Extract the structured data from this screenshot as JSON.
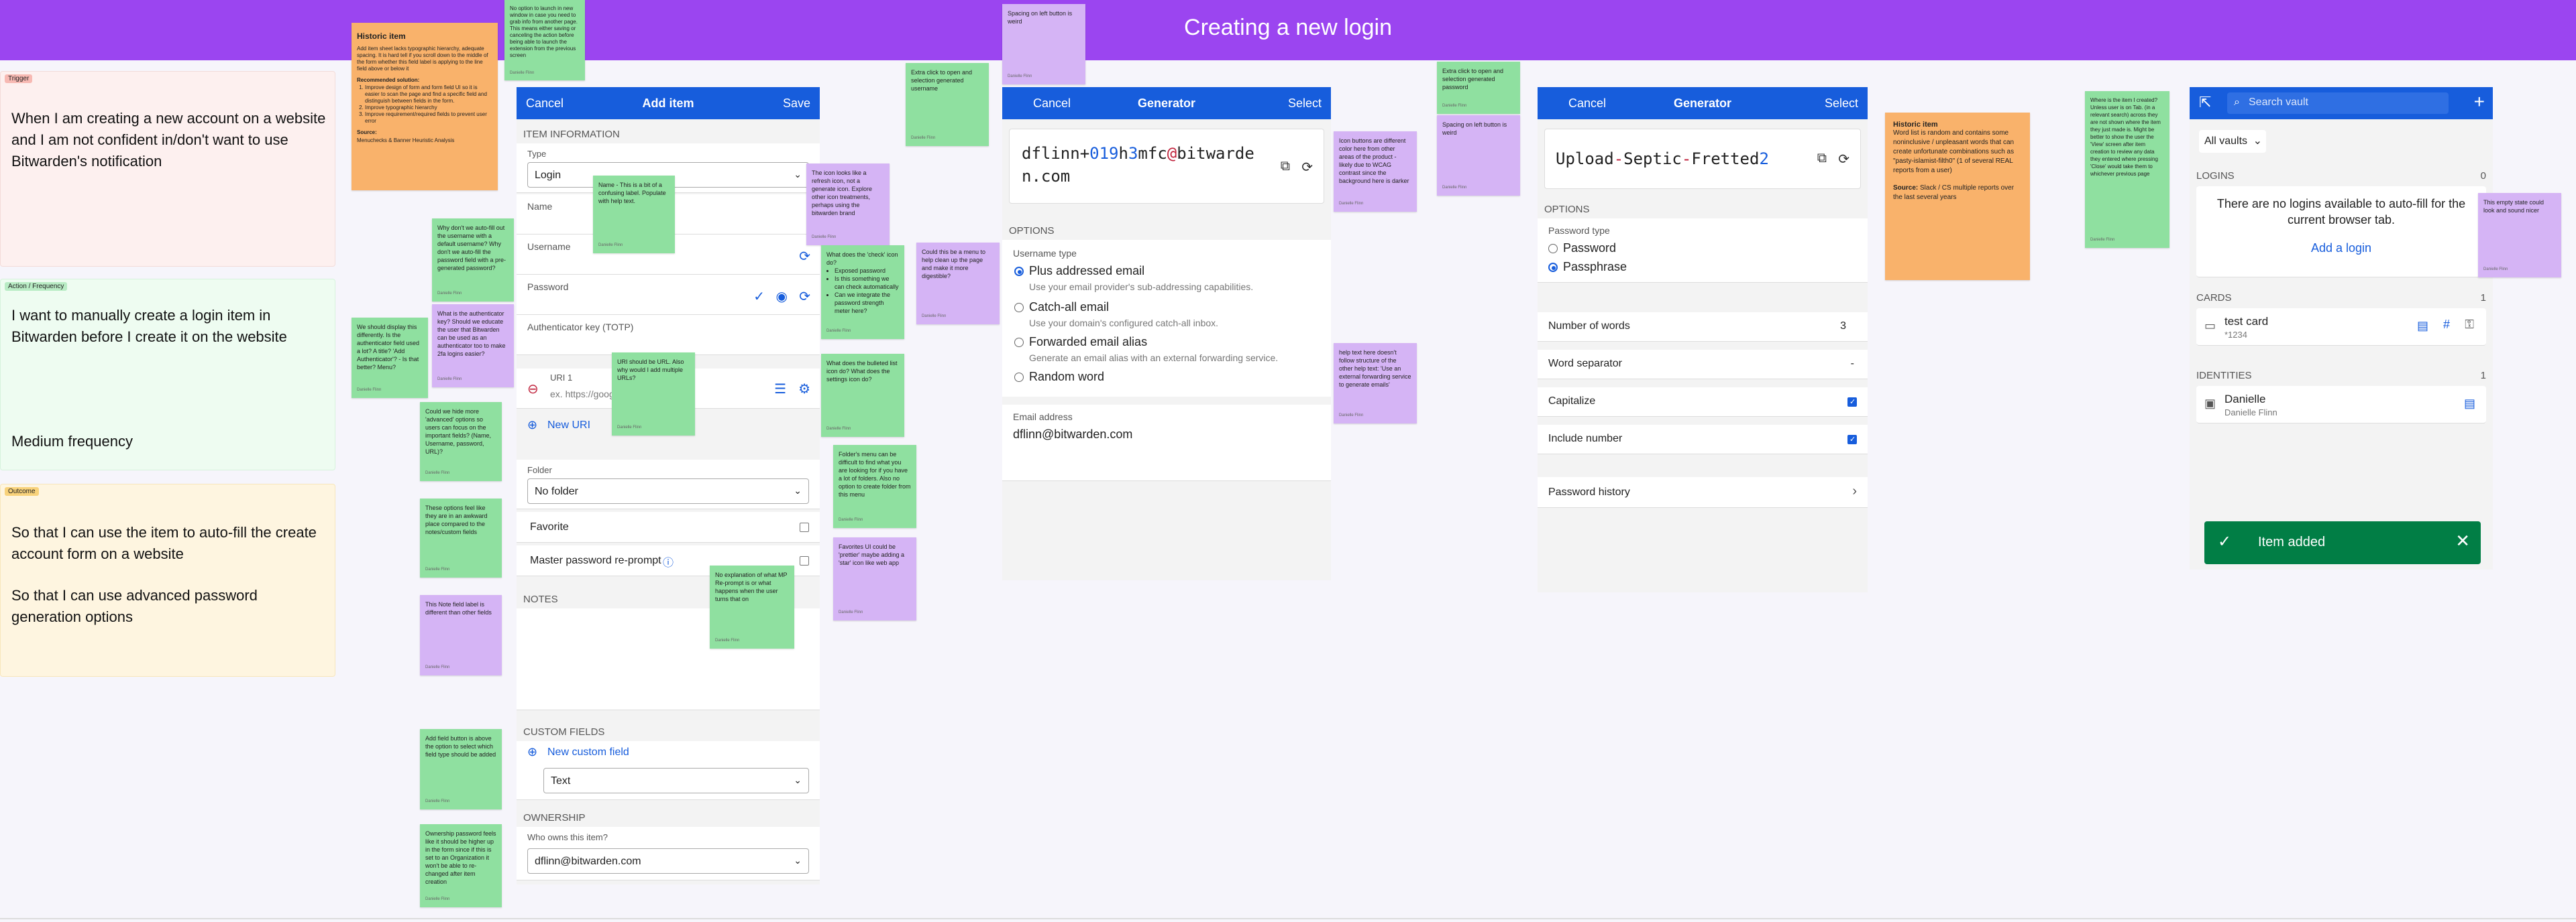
{
  "page": {
    "title": "Creating a new login"
  },
  "cards": {
    "trigger": {
      "tag": "Trigger",
      "text": "When I am creating a new account on a website and I am not confident in/don't want to use Bitwarden's notification"
    },
    "action": {
      "tag": "Action / Frequency",
      "text": "I want to manually create a login item in Bitwarden before I create it on the website",
      "frequency": "Medium frequency"
    },
    "outcome": {
      "tag": "Outcome",
      "text1": "So that I can use the item to auto-fill the create account form on a website",
      "text2": "So that I can use advanced password generation options"
    }
  },
  "stickies": {
    "historic1_title": "Historic item",
    "historic1_body": "Add item sheet lacks typographic hierarchy, adequate spacing. It is hard tell if you scroll down to the middle of the form whether this field label is applying to the line field above or below it",
    "historic1_rec": "Recommended solution:",
    "historic1_items": [
      "Improve design of form and form field UI so it is easier to scan the page and find a specific field and distinguish between fields in the form.",
      "Improve typographic hierarchy",
      "Improve requirement/required fields to prevent user error"
    ],
    "historic1_source_label": "Source:",
    "historic1_source": "Menuchecks & Banner Heuristic Analysis",
    "s_top": "No option to launch in new window in case you need to grab info from another page. This means either saving or canceling the action before being able to launch the extension from the previous screen",
    "s_name": "Name - This is a bit of a confusing label. Populate with help text.",
    "s_refresh": "The icon looks like a refresh icon, not a generate icon. Explore other icon treatments, perhaps using the bitwarden brand",
    "s_extra_click": "Extra click to open and selection generated username",
    "s_spacing1": "Spacing on left button is weird",
    "s_menu": "Could this be a menu to help clean up the page and make it more digestible?",
    "s_autofill": "Why don't we auto-fill out the username with a default username? Why don't we auto-fill the password field with a pre-generated password?",
    "s_authkey": "What is the authenticator key? Should we educate the user that Bitwarden can be used as an authenticator too to make 2fa logins easier?",
    "s_uri": "URI should be URL. Also why would I add multiple URLs?",
    "s_display": "We should display this differently. Is the authenticator field used a lot? A title? 'Add Authenticator'? - Is that better? Menu?",
    "s_check": "What does the 'check' icon do?",
    "s_check_items": [
      "Exposed password",
      "Is this something we can check automatically",
      "Can we integrate the password strength meter here?"
    ],
    "s_bulleted": "What does the bulleted list icon do? What does the settings icon do?",
    "s_advanced": "Could we hide more 'advanced' options so users can focus on the important fields? (Name, Username, password, URL)?",
    "s_folders": "Folder's menu can be difficult to find what you are looking for if you have a lot of folders. Also no option to create folder from this menu",
    "s_tabs": "These options feel like they are in an awkward place compared to the notes/custom fields",
    "s_favorite": "Favorites UI could be 'prettier' maybe adding a 'star' icon like web app",
    "s_no_expl": "No explanation of what MP Re-prompt is or what happens when the user turns that on",
    "s_notes": "This Note field label is different than other fields",
    "s_add_field": "Add field button is above the option to select which field type should be added",
    "s_ownership": "Ownership password feels like it should be higher up in the form since if this is set to an Organization it won't be able to re-changed after item creation",
    "s_icons_diff": "Icon buttons are different color here from other areas of the product - likely due to WCAG contrast since the background here is darker",
    "s_help_text": "help text here doesn't follow structure of the other help text: 'Use an external forwarding service to generate emails'",
    "s_extra2": "Extra click to open and selection generated password",
    "s_spacing2": "Spacing on left button is weird",
    "historic2_title": "Historic item",
    "historic2_body": "Word list is random and contains some noninclusive / unpleasant words that can create unfortunate combinations such as \"pasty-islamist-filth0\" (1 of several REAL reports from a user)",
    "historic2_source_label": "Source:",
    "historic2_source": "Slack / CS multiple reports over the last several years",
    "s_where": "Where is the item I created? Unless user is on Tab. (in a relevant search) across they are not shown where the item they just made is. Might be better to show the user the 'View' screen after item creation to review any data they entered where pressing 'Close' would take them to whichever previous page",
    "s_empty": "This empty state could look and sound nicer",
    "author": "Danielle Flinn"
  },
  "add_item": {
    "cancel": "Cancel",
    "title": "Add item",
    "save": "Save",
    "section_info": "ITEM INFORMATION",
    "type_label": "Type",
    "type_value": "Login",
    "name_label": "Name",
    "username_label": "Username",
    "password_label": "Password",
    "totp_label": "Authenticator key (TOTP)",
    "uri_label": "URI 1",
    "uri_placeholder": "ex. https://google.com",
    "new_uri": "New URI",
    "folder_label": "Folder",
    "folder_value": "No folder",
    "favorite_label": "Favorite",
    "reprompt_label": "Master password re-prompt",
    "notes_section": "NOTES",
    "custom_section": "CUSTOM FIELDS",
    "new_custom_field": "New custom field",
    "custom_type": "Text",
    "ownership_section": "OWNERSHIP",
    "owner_label": "Who owns this item?",
    "owner_value": "dflinn@bitwarden.com"
  },
  "generator1": {
    "cancel": "Cancel",
    "title": "Generator",
    "select": "Select",
    "pass_line1": [
      [
        "t",
        "dflinn+"
      ],
      [
        "n",
        "019"
      ],
      [
        "t",
        "h"
      ],
      [
        "n",
        "3"
      ],
      [
        "t",
        "mfc"
      ],
      [
        "s",
        "@"
      ],
      [
        "t",
        "bitwarde"
      ]
    ],
    "pass_line2": "n.com",
    "options_section": "OPTIONS",
    "username_type_label": "Username type",
    "opt1": "Plus addressed email",
    "opt1_hint": "Use your email provider's sub-addressing capabilities.",
    "opt2": "Catch-all email",
    "opt2_hint": "Use your domain's configured catch-all inbox.",
    "opt3": "Forwarded email alias",
    "opt3_hint": "Generate an email alias with an external forwarding service.",
    "opt4": "Random word",
    "email_label": "Email address",
    "email_value": "dflinn@bitwarden.com"
  },
  "generator2": {
    "cancel": "Cancel",
    "title": "Generator",
    "select": "Select",
    "pass_parts": [
      [
        "t",
        "Upload"
      ],
      [
        "s",
        "-"
      ],
      [
        "t",
        "Septic"
      ],
      [
        "s",
        "-"
      ],
      [
        "t",
        "Fretted"
      ],
      [
        "n",
        "2"
      ]
    ],
    "options_section": "OPTIONS",
    "pw_type_label": "Password type",
    "pw_opt1": "Password",
    "pw_opt2": "Passphrase",
    "num_words_label": "Number of words",
    "num_words_value": "3",
    "separator_label": "Word separator",
    "separator_value": "-",
    "capitalize_label": "Capitalize",
    "include_number_label": "Include number",
    "history_label": "Password history"
  },
  "vault": {
    "search_placeholder": "Search vault",
    "all_vaults": "All vaults",
    "logins_section": "LOGINS",
    "logins_count": "0",
    "no_logins": "There are no logins available to auto-fill for the current browser tab.",
    "add_login": "Add a login",
    "cards_section": "CARDS",
    "cards_count": "1",
    "card_name": "test card",
    "card_sub": "*1234",
    "identities_section": "IDENTITIES",
    "identities_count": "1",
    "identity_name": "Danielle",
    "identity_sub": "Danielle Flinn",
    "toast": "Item added"
  },
  "colors": {
    "banner": "#9b45f0",
    "brand_blue": "#175ddc",
    "toast_green": "#017e45",
    "sticky_green": "#8fe0a0",
    "sticky_purple": "#d5b4f5",
    "sticky_orange": "#f9b26b"
  }
}
